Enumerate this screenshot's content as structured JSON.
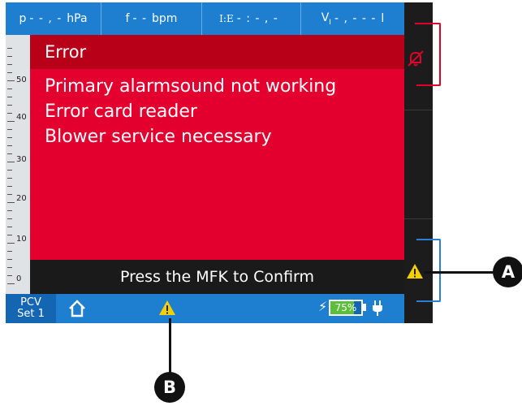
{
  "top_bar": {
    "cells": [
      {
        "param": "p",
        "value": "- - , -",
        "unit": "hPa"
      },
      {
        "param": "f",
        "value": "- -",
        "unit": "bpm"
      },
      {
        "param": "I:E",
        "value": "- : - , -",
        "unit": ""
      },
      {
        "param": "V",
        "sub": "I",
        "value": "- , - - -",
        "unit": "l"
      }
    ]
  },
  "scale": {
    "labels": [
      "50",
      "40",
      "30",
      "20",
      "10",
      "0"
    ]
  },
  "error_panel": {
    "title": "Error",
    "messages": [
      "Primary alarmsound not working",
      "Error card reader",
      "Blower service necessary"
    ]
  },
  "confirm_bar": {
    "text": "Press the MFK to Confirm"
  },
  "bottom_bar": {
    "mode_line1": "PCV",
    "mode_line2": "Set 1",
    "battery_percent": "75%",
    "battery_level": 0.75
  },
  "icons": {
    "home": "home-icon",
    "warning": "warning-icon",
    "bolt": "lightning-icon",
    "plug": "power-plug-icon",
    "alarm_mute": "alarm-bell-off-icon"
  },
  "callouts": {
    "a": "A",
    "b": "B"
  },
  "colors": {
    "status_blue": "#1e7fd0",
    "error_red": "#e3002f",
    "error_header_red": "#b80018",
    "warning_yellow": "#f5d000",
    "battery_green": "#5bbf3a"
  }
}
